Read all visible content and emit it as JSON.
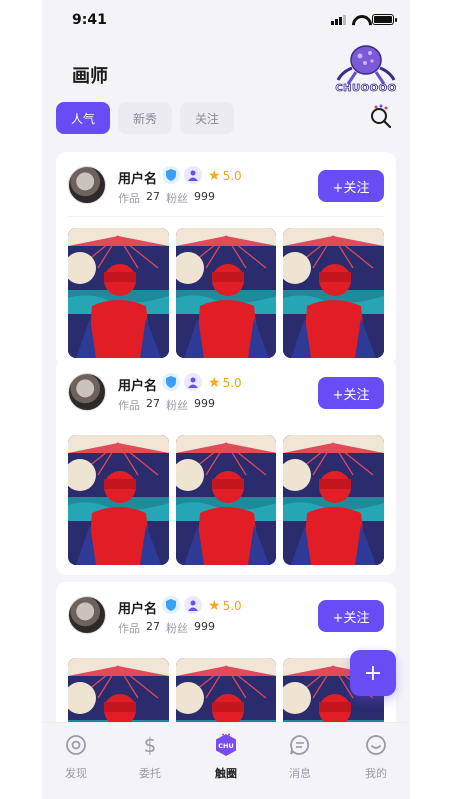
{
  "status_bar": {
    "time": "9:41"
  },
  "header": {
    "title": "画师",
    "logo_text": "CHUOOOO"
  },
  "tabs": [
    {
      "label": "人气",
      "active": true
    },
    {
      "label": "新秀",
      "active": false
    },
    {
      "label": "关注",
      "active": false
    }
  ],
  "cards": [
    {
      "username": "用户名",
      "rating": "5.0",
      "works_label": "作品",
      "works_count": "27",
      "fans_label": "粉丝",
      "fans_count": "999",
      "follow_label": "+关注"
    },
    {
      "username": "用户名",
      "rating": "5.0",
      "works_label": "作品",
      "works_count": "27",
      "fans_label": "粉丝",
      "fans_count": "999",
      "follow_label": "+关注"
    },
    {
      "username": "用户名",
      "rating": "5.0",
      "works_label": "作品",
      "works_count": "27",
      "fans_label": "粉丝",
      "fans_count": "999",
      "follow_label": "+关注"
    }
  ],
  "fab": {
    "label": "+"
  },
  "nav": [
    {
      "label": "发现",
      "icon": "compass-icon",
      "active": false
    },
    {
      "label": "委托",
      "icon": "dollar-icon",
      "active": false
    },
    {
      "label": "触圈",
      "icon": "circle-logo-icon",
      "active": true
    },
    {
      "label": "消息",
      "icon": "message-icon",
      "active": false
    },
    {
      "label": "我的",
      "icon": "smile-icon",
      "active": false
    }
  ],
  "colors": {
    "accent": "#6a4cf5",
    "rating": "#f2a61c",
    "background": "#f4f4f8"
  }
}
